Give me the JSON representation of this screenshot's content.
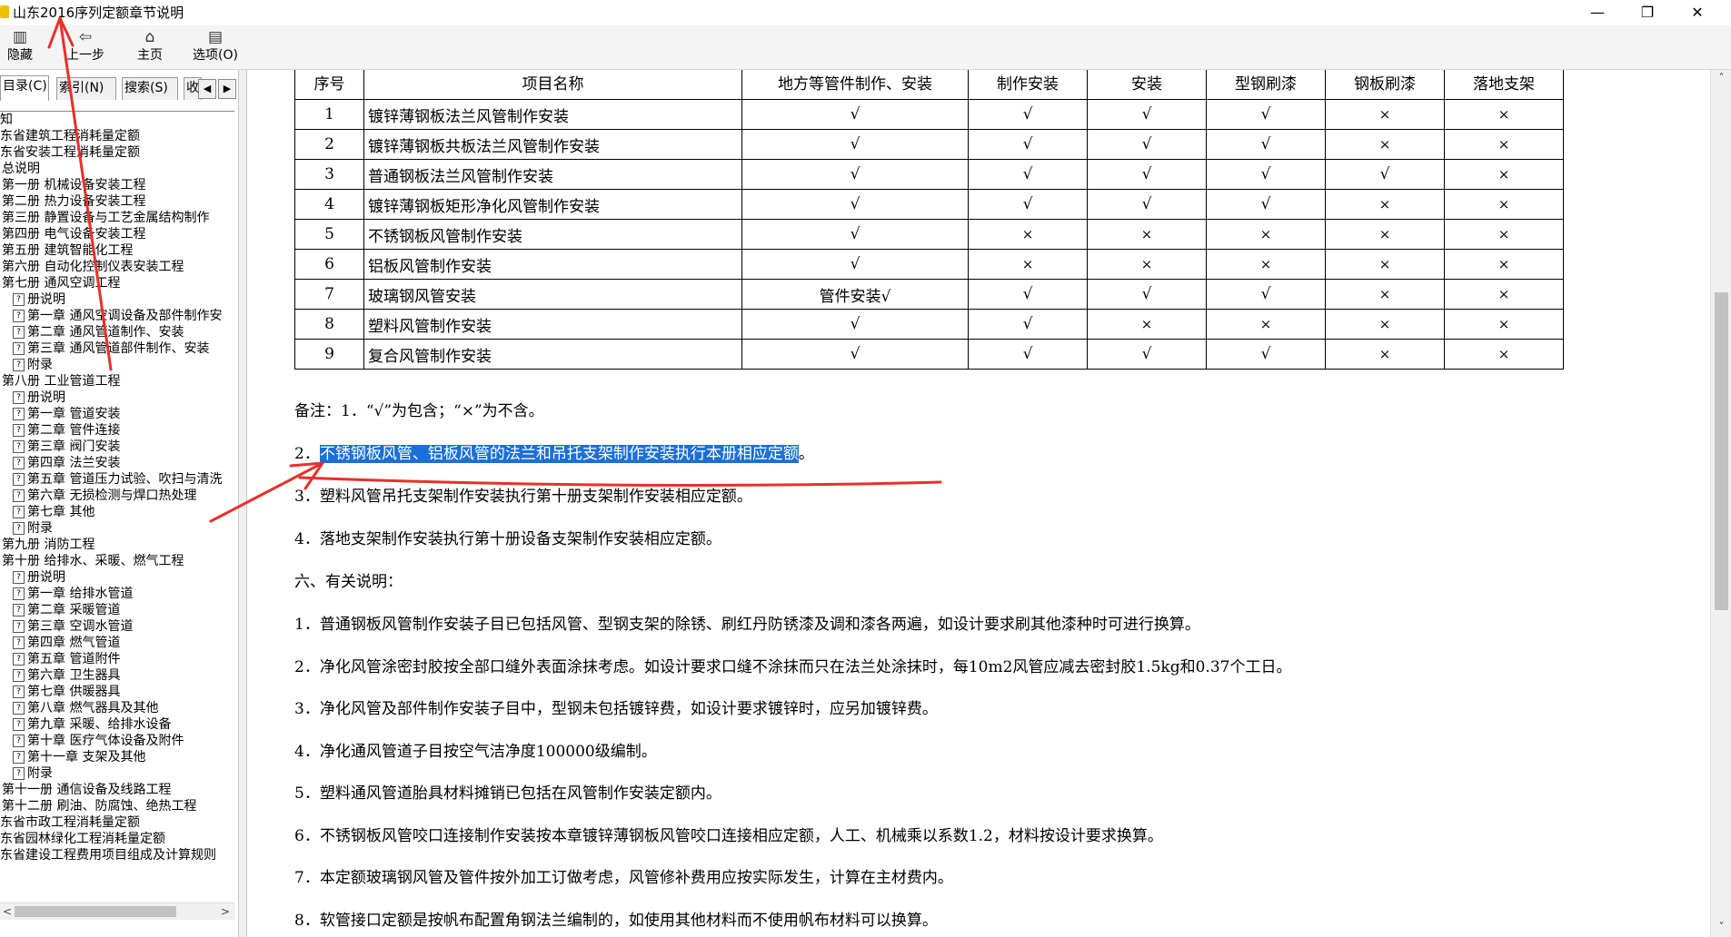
{
  "window": {
    "title": "山东2016序列定额章节说明",
    "app_icon": "help-book-icon",
    "controls": {
      "minimize": "—",
      "restore": "❐",
      "close": "✕"
    }
  },
  "toolbar": {
    "buttons": [
      {
        "label": "隐藏",
        "icon": "hide-icon",
        "glyph": "▥"
      },
      {
        "label": "上一步",
        "icon": "back-arrow-icon",
        "glyph": "⇦"
      },
      {
        "label": "主页",
        "icon": "home-icon",
        "glyph": "⌂"
      },
      {
        "label": "选项(O)",
        "icon": "options-icon",
        "glyph": "▤"
      }
    ]
  },
  "nav": {
    "tabs": [
      "目录(C)",
      "索引(N)",
      "搜索(S)",
      "收"
    ],
    "tree": [
      "知",
      "东省建筑工程消耗量定额",
      "东省安装工程消耗量定额",
      "总说明",
      "第一册  机械设备安装工程",
      "第二册  热力设备安装工程",
      "第三册  静置设备与工艺金属结构制作",
      "第四册  电气设备安装工程",
      "第五册  建筑智能化工程",
      "第六册  自动化控制仪表安装工程",
      "第七册  通风空调工程",
      "册说明",
      "第一章  通风空调设备及部件制作安",
      "第二章  通风管道制作、安装",
      "第三章  通风管道部件制作、安装",
      "附录",
      "第八册  工业管道工程",
      "册说明",
      "第一章  管道安装",
      "第二章  管件连接",
      "第三章  阀门安装",
      "第四章  法兰安装",
      "第五章  管道压力试验、吹扫与清洗",
      "第六章  无损检测与焊口热处理",
      "第七章  其他",
      "附录",
      "第九册  消防工程",
      "第十册  给排水、采暖、燃气工程",
      "册说明",
      "第一章  给排水管道",
      "第二章  采暖管道",
      "第三章  空调水管道",
      "第四章  燃气管道",
      "第五章  管道附件",
      "第六章  卫生器具",
      "第七章  供暖器具",
      "第八章  燃气器具及其他",
      "第九章  采暖、给排水设备",
      "第十章  医疗气体设备及附件",
      "第十一章  支架及其他",
      "附录",
      "第十一册  通信设备及线路工程",
      "第十二册  刷油、防腐蚀、绝热工程",
      "东省市政工程消耗量定额",
      "东省园林绿化工程消耗量定额",
      "东省建设工程费用项目组成及计算规则"
    ]
  },
  "table": {
    "headers": [
      "序号",
      "项目名称",
      "地方等管件制作、安装",
      "制作安装",
      "安装",
      "型钢刷漆",
      "钢板刷漆",
      "落地支架"
    ],
    "rows": [
      [
        "1",
        "镀锌薄钢板法兰风管制作安装",
        "√",
        "√",
        "√",
        "√",
        "×",
        "×"
      ],
      [
        "2",
        "镀锌薄钢板共板法兰风管制作安装",
        "√",
        "√",
        "√",
        "√",
        "×",
        "×"
      ],
      [
        "3",
        "普通钢板法兰风管制作安装",
        "√",
        "√",
        "√",
        "√",
        "√",
        "×"
      ],
      [
        "4",
        "镀锌薄钢板矩形净化风管制作安装",
        "√",
        "√",
        "√",
        "√",
        "×",
        "×"
      ],
      [
        "5",
        "不锈钢板风管制作安装",
        "√",
        "×",
        "×",
        "×",
        "×",
        "×"
      ],
      [
        "6",
        "铝板风管制作安装",
        "√",
        "×",
        "×",
        "×",
        "×",
        "×"
      ],
      [
        "7",
        "玻璃钢风管安装",
        "管件安装√",
        "√",
        "√",
        "√",
        "×",
        "×"
      ],
      [
        "8",
        "塑料风管制作安装",
        "√",
        "√",
        "×",
        "×",
        "×",
        "×"
      ],
      [
        "9",
        "复合风管制作安装",
        "√",
        "√",
        "√",
        "√",
        "×",
        "×"
      ]
    ]
  },
  "notes": {
    "note1": "备注：1．“√”为包含；“×”为不含。",
    "note2_prefix": "2．",
    "note2_highlight": "不锈钢板风管、铝板风管的法兰和吊托支架制作安装执行本册相应定额",
    "note2_suffix": "。",
    "note3": "3．塑料风管吊托支架制作安装执行第十册支架制作安装相应定额。",
    "note4": "4．落地支架制作安装执行第十册设备支架制作安装相应定额。",
    "section6": "六、有关说明：",
    "items": [
      "1．普通钢板风管制作安装子目已包括风管、型钢支架的除锈、刷红丹防锈漆及调和漆各两遍，如设计要求刷其他漆种时可进行换算。",
      "2．净化风管涂密封胶按全部口缝外表面涂抹考虑。如设计要求口缝不涂抹而只在法兰处涂抹时，每10m2风管应减去密封胶1.5kg和0.37个工日。",
      "3．净化风管及部件制作安装子目中，型钢未包括镀锌费，如设计要求镀锌时，应另加镀锌费。",
      "4．净化通风管道子目按空气洁净度100000级编制。",
      "5．塑料通风管道胎具材料摊销已包括在风管制作安装定额内。",
      "6．不锈钢板风管咬口连接制作安装按本章镀锌薄钢板风管咬口连接相应定额，人工、机械乘以系数1.2，材料按设计要求换算。",
      "7．本定额玻璃钢风管及管件按外加工订做考虑，风管修补费用应按实际发生，计算在主材费内。",
      "8．软管接口定额是按帆布配置角钢法兰编制的，如使用其他材料而不使用帆布材料可以换算。"
    ]
  },
  "colors": {
    "selection": "#1c6fd6",
    "annotation": "#e8302a"
  }
}
